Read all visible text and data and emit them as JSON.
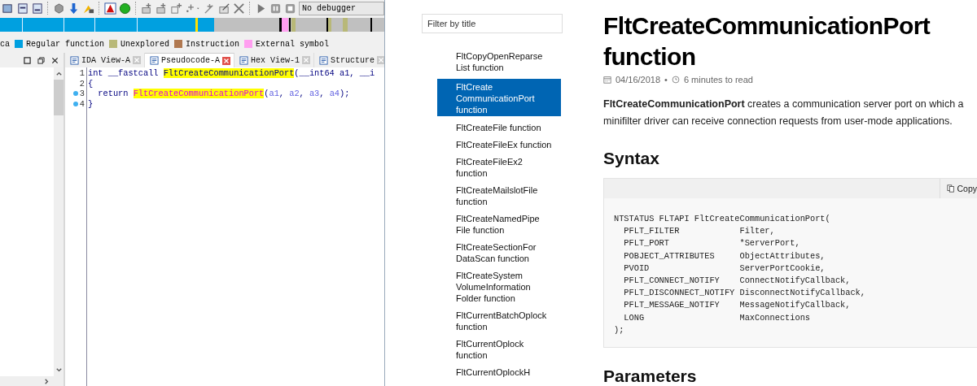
{
  "ida": {
    "debugger_select": {
      "value": "No debugger"
    },
    "legend_cut_text": "ca",
    "legend": [
      {
        "label": "Regular function",
        "color": "#00a0e0"
      },
      {
        "label": "Unexplored",
        "color": "#b8b878"
      },
      {
        "label": "Instruction",
        "color": "#b07850"
      },
      {
        "label": "External symbol",
        "color": "#ff9ff0"
      }
    ],
    "tabs": [
      {
        "label": "IDA View-A",
        "selected": false
      },
      {
        "label": "Pseudocode-A",
        "selected": true
      },
      {
        "label": "Hex View-1",
        "selected": false
      },
      {
        "label": "Structure",
        "selected": false
      }
    ],
    "code_lines": [
      {
        "number": "1",
        "breakpoint": false,
        "tokens": [
          {
            "kind": "plain",
            "text": "int __fastcall "
          },
          {
            "kind": "name",
            "text": "FltCreateCommunicationPort"
          },
          {
            "kind": "plain",
            "text": "(__int64 a1, __i"
          }
        ]
      },
      {
        "number": "2",
        "breakpoint": false,
        "tokens": [
          {
            "kind": "plain",
            "text": "{"
          }
        ]
      },
      {
        "number": "3",
        "breakpoint": true,
        "tokens": [
          {
            "kind": "plain",
            "text": "  return "
          },
          {
            "kind": "call",
            "text": "FltCreateCommunicationPort"
          },
          {
            "kind": "plain",
            "text": "("
          },
          {
            "kind": "var",
            "text": "a1"
          },
          {
            "kind": "plain",
            "text": ", "
          },
          {
            "kind": "var",
            "text": "a2"
          },
          {
            "kind": "plain",
            "text": ", "
          },
          {
            "kind": "var",
            "text": "a3"
          },
          {
            "kind": "plain",
            "text": ", "
          },
          {
            "kind": "var",
            "text": "a4"
          },
          {
            "kind": "plain",
            "text": ");"
          }
        ]
      },
      {
        "number": "4",
        "breakpoint": true,
        "tokens": [
          {
            "kind": "plain",
            "text": "}"
          }
        ]
      }
    ]
  },
  "docs": {
    "filter": {
      "placeholder": "Filter by title"
    },
    "toc": [
      {
        "label": "FltCopyOpenReparse\nList function",
        "selected": false
      },
      {
        "label": "FltCreate\nCommunicationPort\nfunction",
        "selected": true
      },
      {
        "label": "FltCreateFile function",
        "selected": false
      },
      {
        "label": "FltCreateFileEx function",
        "selected": false
      },
      {
        "label": "FltCreateFileEx2\nfunction",
        "selected": false
      },
      {
        "label": "FltCreateMailslotFile\nfunction",
        "selected": false
      },
      {
        "label": "FltCreateNamedPipe\nFile function",
        "selected": false
      },
      {
        "label": "FltCreateSectionFor\nDataScan function",
        "selected": false
      },
      {
        "label": "FltCreateSystem\nVolumeInformation\nFolder function",
        "selected": false
      },
      {
        "label": "FltCurrentBatchOplock\nfunction",
        "selected": false
      },
      {
        "label": "FltCurrentOplock\nfunction",
        "selected": false
      },
      {
        "label": "FltCurrentOplockH",
        "selected": false
      }
    ],
    "title": "FltCreateCommunicationPort function",
    "date": "04/16/2018",
    "separator": "•",
    "read_time": "6 minutes to read",
    "description": "**FltCreateCommunicationPort** creates a communication server port on which a minifilter driver can receive connection requests from user-mode applications.",
    "syntax_heading": "Syntax",
    "copy_button": "Copy",
    "syntax_code": "NTSTATUS FLTAPI FltCreateCommunicationPort(\n  PFLT_FILTER            Filter,\n  PFLT_PORT              *ServerPort,\n  POBJECT_ATTRIBUTES     ObjectAttributes,\n  PVOID                  ServerPortCookie,\n  PFLT_CONNECT_NOTIFY    ConnectNotifyCallback,\n  PFLT_DISCONNECT_NOTIFY DisconnectNotifyCallback,\n  PFLT_MESSAGE_NOTIFY    MessageNotifyCallback,\n  LONG                   MaxConnections\n);",
    "parameters_heading": "Parameters"
  }
}
